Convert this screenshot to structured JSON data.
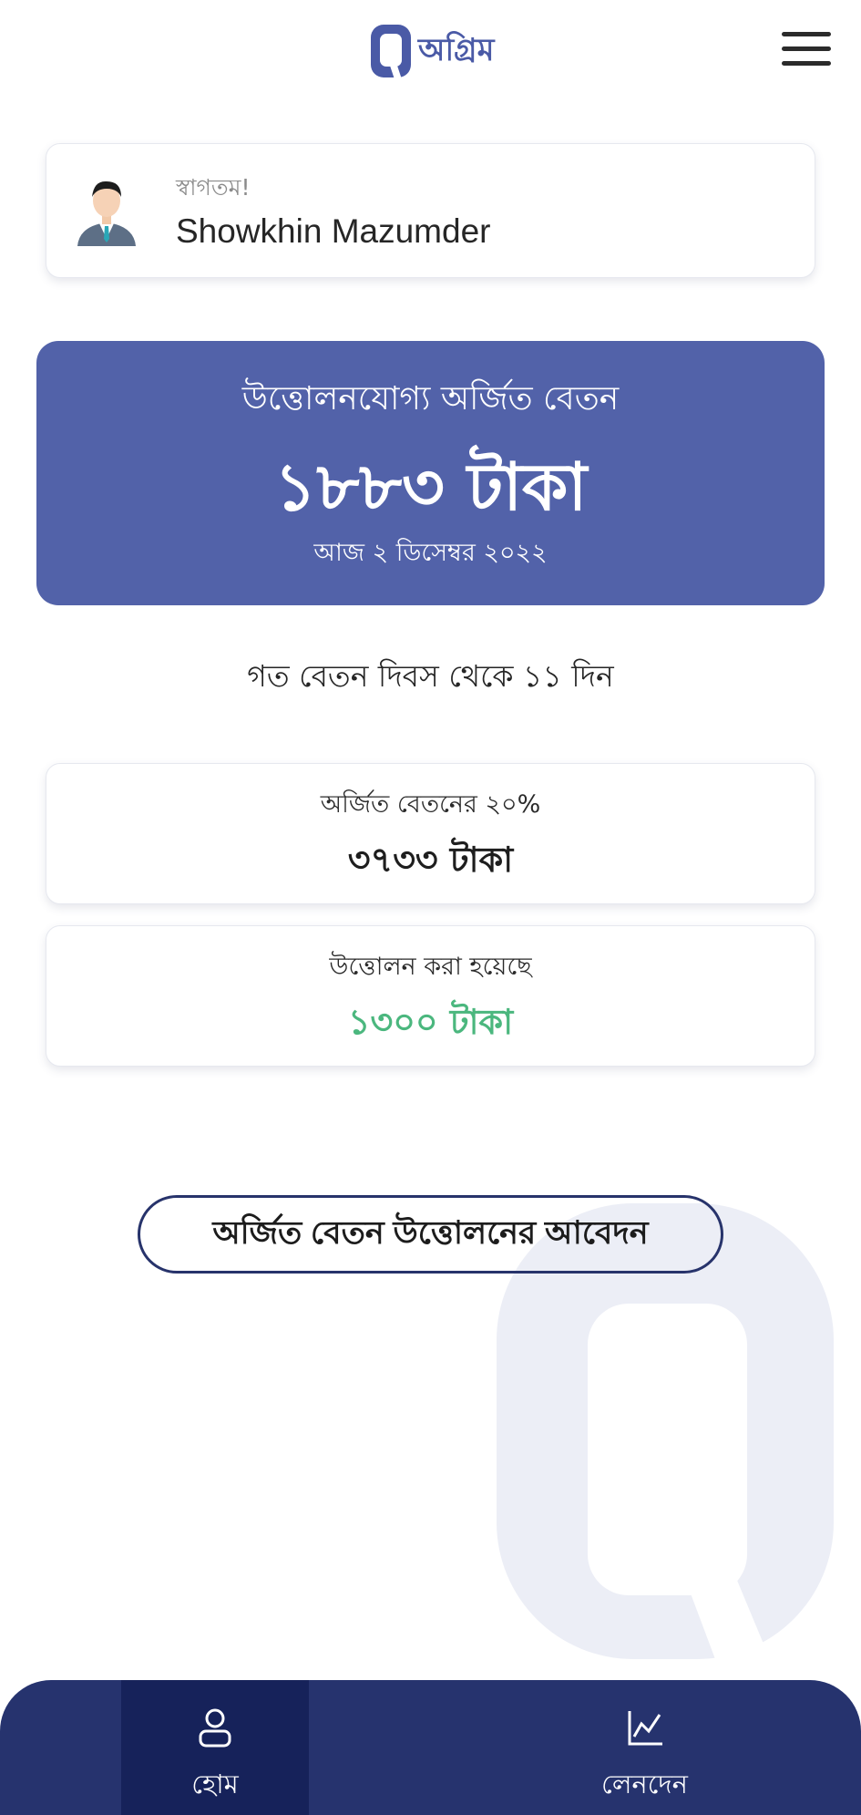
{
  "header": {
    "logo_text": "অগ্রিম",
    "menu_icon": "hamburger-menu-icon"
  },
  "welcome": {
    "greeting": "স্বাগতম!",
    "user_name": "Showkhin Mazumder",
    "avatar_icon": "user-avatar-icon"
  },
  "earned_wage": {
    "title": "উত্তোলনযোগ্য অর্জিত বেতন",
    "amount": "১৮৮৩ টাকা",
    "date": "আজ ২ ডিসেম্বর ২০২২"
  },
  "days_since_payday": "গত বেতন দিবস থেকে ১১ দিন",
  "stats": [
    {
      "label": "অর্জিত বেতনের ২০%",
      "value": "৩৭৩৩ টাকা"
    },
    {
      "label": "উত্তোলন করা হয়েছে",
      "value": "১৩০০ টাকা"
    }
  ],
  "apply_button": "অর্জিত বেতন উত্তোলনের আবেদন",
  "bottom_nav": [
    {
      "label": "হোম",
      "icon": "user-icon",
      "active": true
    },
    {
      "label": "লেনদেন",
      "icon": "chart-line-icon",
      "active": false
    }
  ],
  "colors": {
    "primary": "#5262a9",
    "nav_bg": "#26336e",
    "nav_active": "#16225a",
    "success": "#4bb77e"
  }
}
